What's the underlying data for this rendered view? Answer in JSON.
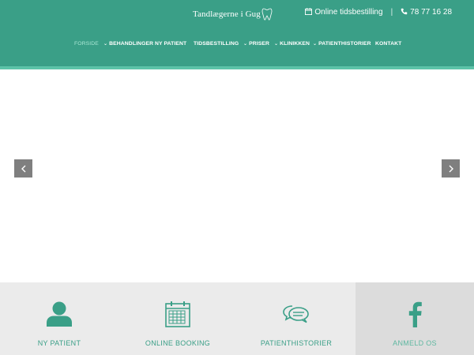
{
  "brand": {
    "name": "Tandlægerne i Gug",
    "color_primary": "#3a9f87",
    "color_accent": "#5cc3a8"
  },
  "topbar": {
    "booking_icon": "calendar-icon",
    "booking_label": "Online tidsbestilling",
    "separator": "|",
    "phone_icon": "phone-icon",
    "phone": "78 77 16 28"
  },
  "nav": {
    "items": [
      {
        "label": "FORSIDE",
        "dropdown": false,
        "active": true
      },
      {
        "label": "BEHANDLINGER",
        "dropdown": true,
        "active": false
      },
      {
        "label": "NY PATIENT",
        "dropdown": false,
        "active": false
      },
      {
        "label": "TIDSBESTILLING",
        "dropdown": false,
        "active": false
      },
      {
        "label": "PRISER",
        "dropdown": true,
        "active": false
      },
      {
        "label": "KLINIKKEN",
        "dropdown": true,
        "active": false
      },
      {
        "label": "PATIENTHISTORIER",
        "dropdown": true,
        "active": false
      },
      {
        "label": "KONTAKT",
        "dropdown": false,
        "active": false
      }
    ],
    "dropdown_glyph": "⌄"
  },
  "slider": {
    "prev_icon": "chevron-left-icon",
    "next_icon": "chevron-right-icon"
  },
  "tiles": [
    {
      "label": "NY PATIENT",
      "icon": "user-icon"
    },
    {
      "label": "ONLINE BOOKING",
      "icon": "calendar-icon"
    },
    {
      "label": "PATIENTHISTORIER",
      "icon": "chat-icon"
    },
    {
      "label": "ANMELD OS",
      "icon": "facebook-icon"
    }
  ]
}
